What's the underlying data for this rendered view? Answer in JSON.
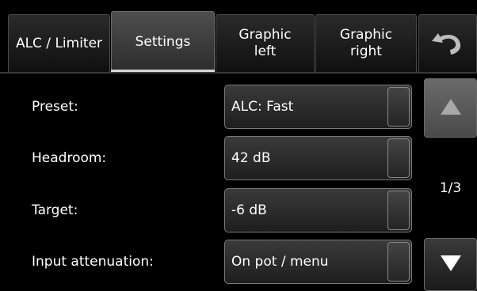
{
  "tabs": [
    {
      "label": "ALC / Limiter"
    },
    {
      "label": "Settings"
    },
    {
      "label": "Graphic\nleft"
    },
    {
      "label": "Graphic\nright"
    }
  ],
  "back_icon": "undo-arrow-icon",
  "rows": [
    {
      "label": "Preset:",
      "value": "ALC: Fast"
    },
    {
      "label": "Headroom:",
      "value": "42 dB"
    },
    {
      "label": "Target:",
      "value": "-6 dB"
    },
    {
      "label": "Input attenuation:",
      "value": "On pot / menu"
    }
  ],
  "pagination": {
    "indicator": "1/3",
    "up_icon": "triangle-up-icon",
    "down_icon": "triangle-down-icon"
  },
  "colors": {
    "background": "#000000",
    "active_tab": "#3c3c3c",
    "underline": "#d8d8d8"
  }
}
